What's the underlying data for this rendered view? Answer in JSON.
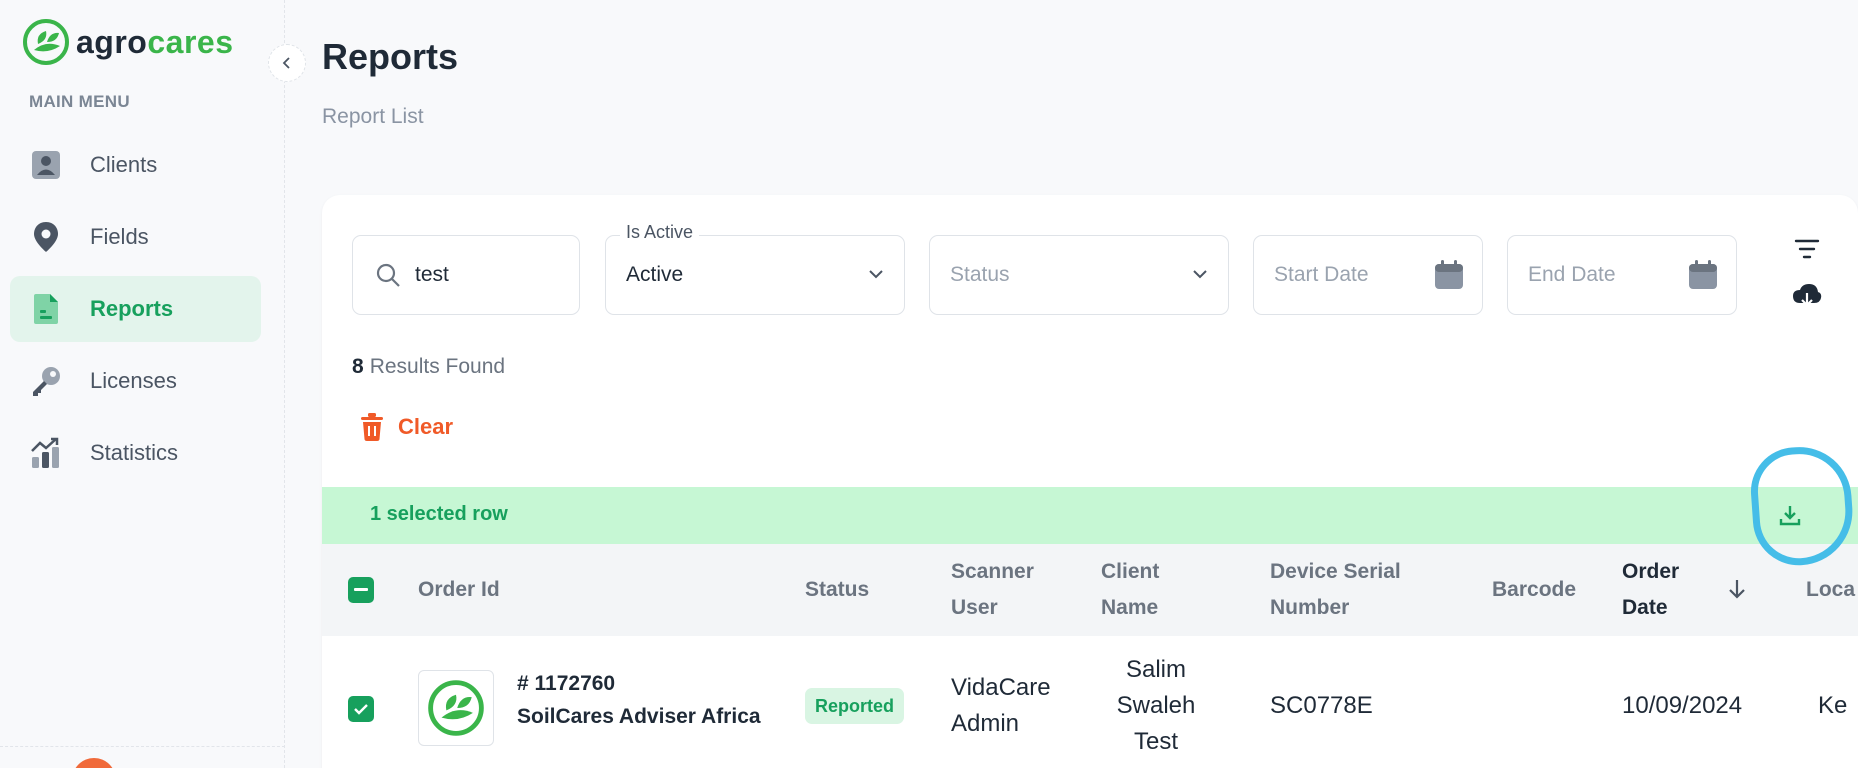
{
  "brand": {
    "name_part1": "agro",
    "name_part2": "cares",
    "colors": {
      "primary": "#17a05d",
      "logo_green": "#3ab54a",
      "danger": "#f05a28",
      "highlight": "#45bde8"
    }
  },
  "sidebar": {
    "menu_title": "MAIN MENU",
    "items": [
      {
        "label": "Clients",
        "icon": "user-icon",
        "active": false
      },
      {
        "label": "Fields",
        "icon": "map-pin-icon",
        "active": false
      },
      {
        "label": "Reports",
        "icon": "document-icon",
        "active": true
      },
      {
        "label": "Licenses",
        "icon": "key-icon",
        "active": false
      },
      {
        "label": "Statistics",
        "icon": "chart-icon",
        "active": false
      }
    ]
  },
  "header": {
    "title": "Reports",
    "breadcrumb": "Report List"
  },
  "filters": {
    "search_value": "test",
    "is_active_label": "Is Active",
    "is_active_value": "Active",
    "status_placeholder": "Status",
    "start_date_placeholder": "Start Date",
    "end_date_placeholder": "End Date"
  },
  "results": {
    "count": "8",
    "label": "Results Found"
  },
  "clear_label": "Clear",
  "selection": {
    "text": "1 selected row"
  },
  "table": {
    "headers": {
      "order_id": "Order Id",
      "status": "Status",
      "scanner_user_1": "Scanner",
      "scanner_user_2": "User",
      "client_name_1": "Client",
      "client_name_2": "Name",
      "device_serial_1": "Device Serial",
      "device_serial_2": "Number",
      "barcode": "Barcode",
      "order_date_1": "Order",
      "order_date_2": "Date",
      "location": "Loca"
    },
    "rows": [
      {
        "order_id": "# 1172760",
        "org": "SoilCares Adviser Africa",
        "status": "Reported",
        "scanner_1": "VidaCare",
        "scanner_2": "Admin",
        "client_1": "Salim",
        "client_2": "Swaleh",
        "client_3": "Test",
        "device_serial": "SC0778E",
        "barcode": "",
        "order_date": "10/09/2024",
        "location": "Ke"
      }
    ]
  }
}
